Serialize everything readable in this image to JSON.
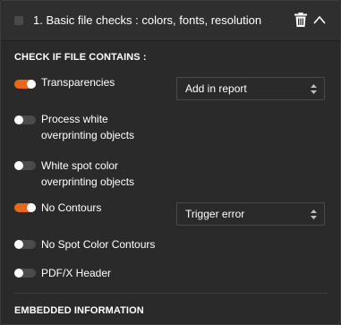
{
  "header": {
    "title": "1.  Basic file checks : colors, fonts, resolution",
    "checkbox_checked": false,
    "icons": [
      "trash-icon",
      "chevron-up-icon"
    ]
  },
  "sections": {
    "check_contains_label": "CHECK IF FILE CONTAINS :",
    "embedded_label": "EMBEDDED INFORMATION"
  },
  "options": [
    {
      "label_line1": "Transparencies",
      "label_line2": "",
      "enabled": true,
      "select": "Add in report"
    },
    {
      "label_line1": "Process white",
      "label_line2": "overprinting objects",
      "enabled": false,
      "select": ""
    },
    {
      "label_line1": "White spot color",
      "label_line2": "overprinting objects",
      "enabled": false,
      "select": ""
    },
    {
      "label_line1": "No Contours",
      "label_line2": "",
      "enabled": true,
      "select": "Trigger error"
    },
    {
      "label_line1": "No Spot Color Contours",
      "label_line2": "",
      "enabled": false,
      "select": ""
    },
    {
      "label_line1": "PDF/X Header",
      "label_line2": "",
      "enabled": false,
      "select": ""
    }
  ],
  "colors": {
    "accent": "#e9661d",
    "background": "#2a2a2a",
    "toggle_off": "#4b4b4b"
  }
}
